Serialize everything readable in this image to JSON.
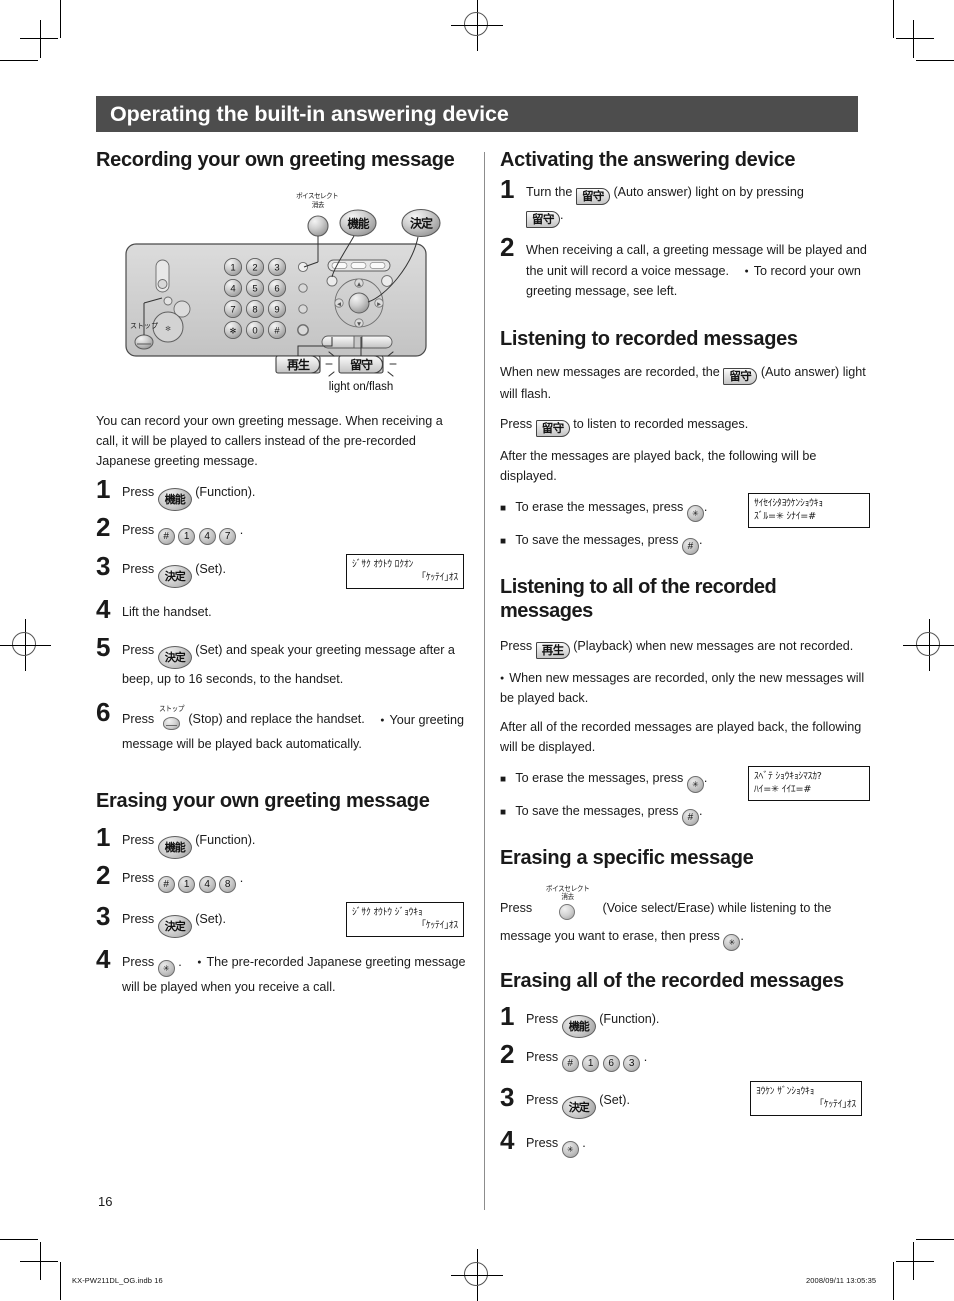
{
  "banner": {
    "title": "Operating the built-in answering device"
  },
  "page": {
    "number": "16"
  },
  "footer": {
    "file": "KX-PW211DL_OG.indb   16",
    "timestamp": "2008/09/11   13:05:35"
  },
  "keys": {
    "function": "機能",
    "set": "決定",
    "auto_answer": "留守",
    "playback": "再生",
    "star": "✳",
    "hash": "#",
    "voice_select_line1": "ボイスセレクト",
    "voice_select_line2": "消去",
    "stop_caption": "ストップ",
    "d1": "1",
    "d2": "2",
    "d3": "3",
    "d4": "4",
    "d5": "5",
    "d6": "6",
    "d7": "7",
    "d8": "8",
    "d9": "9",
    "d0": "0"
  },
  "device": {
    "light_caption": "light on/flash"
  },
  "left": {
    "heading": "Recording your own greeting message",
    "intro": "You can record your own greeting message. When receiving a call, it will be played to callers instead of the pre-recorded Japanese greeting message.",
    "steps": [
      {
        "n": "1",
        "pre": "Press",
        "post": "(Function).",
        "key": "function"
      },
      {
        "n": "2",
        "pre": "Press",
        "post": ".",
        "key": "digits-147"
      },
      {
        "n": "3",
        "pre": "Press",
        "post": "(Set).",
        "key": "set"
      },
      {
        "n": "4",
        "pre": "Lift the handset.",
        "post": "",
        "key": "none"
      },
      {
        "n": "5",
        "pre": "Press",
        "post": "(Set) and speak your greeting message after a beep, up to 16 seconds, to the handset.",
        "key": "set"
      },
      {
        "n": "6",
        "pre": "Press",
        "post": "(Stop) and replace the handset.",
        "key": "stop"
      }
    ],
    "step6_bullet": "Your greeting message will be played back automatically.",
    "lcd1": {
      "line1": "ｼﾞｻｸ ｵｳﾄｳ ﾛｸｵﾝ",
      "line2": "｢ｹｯﾃｲ｣ｵｽ"
    },
    "heading2": "Erasing your own greeting message",
    "steps2": [
      {
        "n": "1",
        "pre": "Press",
        "post": "(Function).",
        "key": "function"
      },
      {
        "n": "2",
        "pre": "Press",
        "post": ".",
        "key": "digits-148"
      },
      {
        "n": "3",
        "pre": "Press",
        "post": "(Set).",
        "key": "set"
      },
      {
        "n": "4",
        "pre": "Press",
        "post": ".",
        "key": "star"
      }
    ],
    "step4_bullet": "The pre-recorded Japanese greeting message will be played when you receive a call.",
    "lcd2": {
      "line1": "ｼﾞｻｸ ｵｳﾄｳ ｼﾞｮｳｷｮ",
      "line2": "｢ｹｯﾃｲ｣ｵｽ"
    }
  },
  "right": {
    "heading1": "Activating the answering device",
    "act_step1_a": "Turn the",
    "act_step1_b": "(Auto answer) light on by pressing",
    "act_step1_c": ".",
    "act_step2": "When receiving a call, a greeting message will be played and the unit will record a voice message.",
    "act_step2_bullet": "To record your own greeting message, see left.",
    "heading2": "Listening to recorded messages",
    "lrm_p1_a": "When new messages are recorded, the",
    "lrm_p1_b": "(Auto answer) light will flash.",
    "lrm_p2_a": "Press",
    "lrm_p2_b": "to listen to recorded messages.",
    "lrm_p3": "After the messages are played back, the following will be displayed.",
    "lrm_erase": "To erase the messages, press",
    "lrm_save": "To save the messages, press",
    "lcd3": {
      "line1": "ｻｲｾｲｼﾀﾖｳｹﾝｼｮｳｷｮ",
      "line2": "ｽﾞﾙ=✳ ｼﾅｲ=#"
    },
    "heading3": "Listening to all of the recorded messages",
    "lall_p1_a": "Press",
    "lall_p1_b": "(Playback) when new messages are not recorded.",
    "lall_bullet": "When new messages are recorded, only the new messages will be played back.",
    "lall_p2": "After all of the recorded messages are played back, the following will be displayed.",
    "lall_erase": "To erase the messages, press",
    "lall_save": "To save the messages, press",
    "lcd4": {
      "line1": "ｽﾍﾞﾃ ｼｮｳｷｮｼﾏｽｶ?",
      "line2": "ﾊｲ=✳ ｲｲｴ=#"
    },
    "heading4": "Erasing a specific message",
    "esp_a": "Press",
    "esp_b": "(Voice select/Erase) while listening to the message you want to erase, then press",
    "esp_c": ".",
    "heading5": "Erasing all of the recorded messages",
    "steps5": [
      {
        "n": "1",
        "pre": "Press",
        "post": "(Function).",
        "key": "function"
      },
      {
        "n": "2",
        "pre": "Press",
        "post": ".",
        "key": "digits-163"
      },
      {
        "n": "3",
        "pre": "Press",
        "post": "(Set).",
        "key": "set"
      },
      {
        "n": "4",
        "pre": "Press",
        "post": ".",
        "key": "star"
      }
    ],
    "lcd5": {
      "line1": "ﾖｳｹﾝ ｻﾞﾝｼｮｳｷｮ",
      "line2": "｢ｹｯﾃｲ｣ｵｽ"
    }
  }
}
